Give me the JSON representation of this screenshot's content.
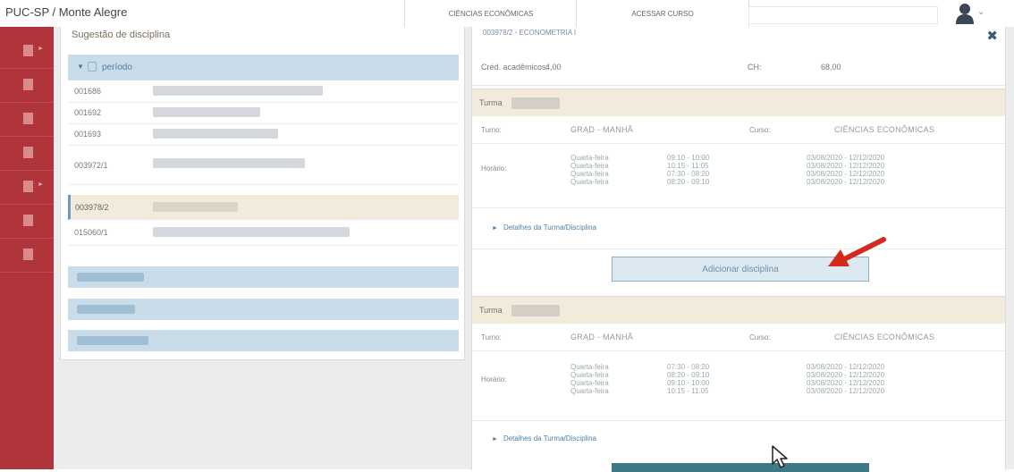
{
  "topbar": {
    "brand": "PUC-SP / Monte Alegre",
    "course_button": "CIÊNCIAS ECONÔMICAS",
    "access_button": "ACESSAR CURSO",
    "search_placeholder": ""
  },
  "left_panel": {
    "title": "Sugestão de disciplina",
    "periodo_label": "período",
    "rows": [
      {
        "code": "001686"
      },
      {
        "code": "001692"
      },
      {
        "code": "001693"
      },
      {
        "code": "003972/1"
      },
      {
        "code": "003978/2"
      },
      {
        "code": "015060/1"
      }
    ]
  },
  "right_panel": {
    "header": "003978/2 - ECONOMETRIA I",
    "cred_label": "Créd. acadêmicos:",
    "cred_value": "4,00",
    "ch_label": "CH:",
    "ch_value": "68,00",
    "turmas": [
      {
        "turma_label": "Turma",
        "turno_label": "Turno:",
        "turno_value": "GRAD - MANHÃ",
        "curso_label": "Curso:",
        "curso_value": "CIÊNCIAS ECONÔMICAS",
        "horario_label": "Horário:",
        "days": "Quarta-feira\nQuarta-feira\nQuarta-feira\nQuarta-feira",
        "times": "09:10 - 10:00\n10:15 - 11:05\n07:30 - 08:20\n08:20 - 09:10",
        "periods": "03/08/2020 - 12/12/2020\n03/08/2020 - 12/12/2020\n03/08/2020 - 12/12/2020\n03/08/2020 - 12/12/2020",
        "details_label": "Detalhes da Turma/Disciplina",
        "add_button": "Adicionar disciplina"
      },
      {
        "turma_label": "Turma",
        "turno_label": "Turno:",
        "turno_value": "GRAD - MANHÃ",
        "curso_label": "Curso:",
        "curso_value": "CIÊNCIAS ECONÔMICAS",
        "horario_label": "Horário:",
        "days": "Quarta-feira\nQuarta-feira\nQuarta-feira\nQuarta-feira",
        "times": "07:30 - 08:20\n08:20 - 09:10\n09:10 - 10:00\n10:15 - 11:05",
        "periods": "03/08/2020 - 12/12/2020\n03/08/2020 - 12/12/2020\n03/08/2020 - 12/12/2020\n03/08/2020 - 12/12/2020",
        "details_label": "Detalhes da Turma/Disciplina"
      }
    ]
  },
  "colors": {
    "rail": "#b0353a",
    "accent_blue": "#c8dce9",
    "selected_row": "#f2eadb",
    "arrow": "#d42a1e"
  }
}
